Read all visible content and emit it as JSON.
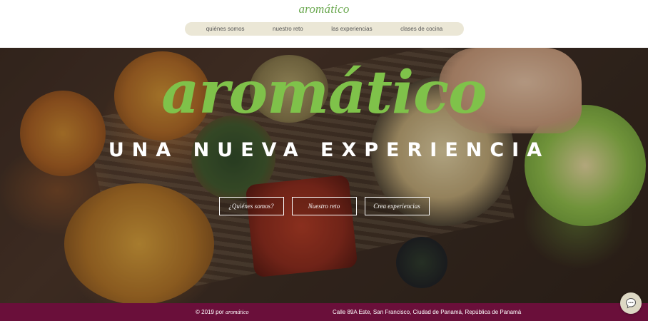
{
  "header": {
    "logo": "aromático",
    "nav": [
      {
        "label": "quiénes somos"
      },
      {
        "label": "nuestro reto"
      },
      {
        "label": "las experiencias"
      },
      {
        "label": "clases de cocina"
      }
    ]
  },
  "hero": {
    "title": "aromático",
    "subtitle": "UNA NUEVA EXPERIENCIA",
    "buttons": [
      {
        "label": "¿Quiénes somos?"
      },
      {
        "label": "Nuestro reto"
      },
      {
        "label": "Crea experiencias"
      }
    ]
  },
  "footer": {
    "copyright_prefix": "© 2019 por",
    "copyright_brand": "aromático",
    "address": "Calle 89A Este, San Francisco, Ciudad de Panamá, República de Panamá"
  },
  "chat": {
    "icon": "chat-bubble-icon"
  },
  "colors": {
    "brand_green": "#6aa84f",
    "nav_bg": "#ebe7d6",
    "footer_bg": "#6a0f3a",
    "button_border": "#ffffff"
  }
}
